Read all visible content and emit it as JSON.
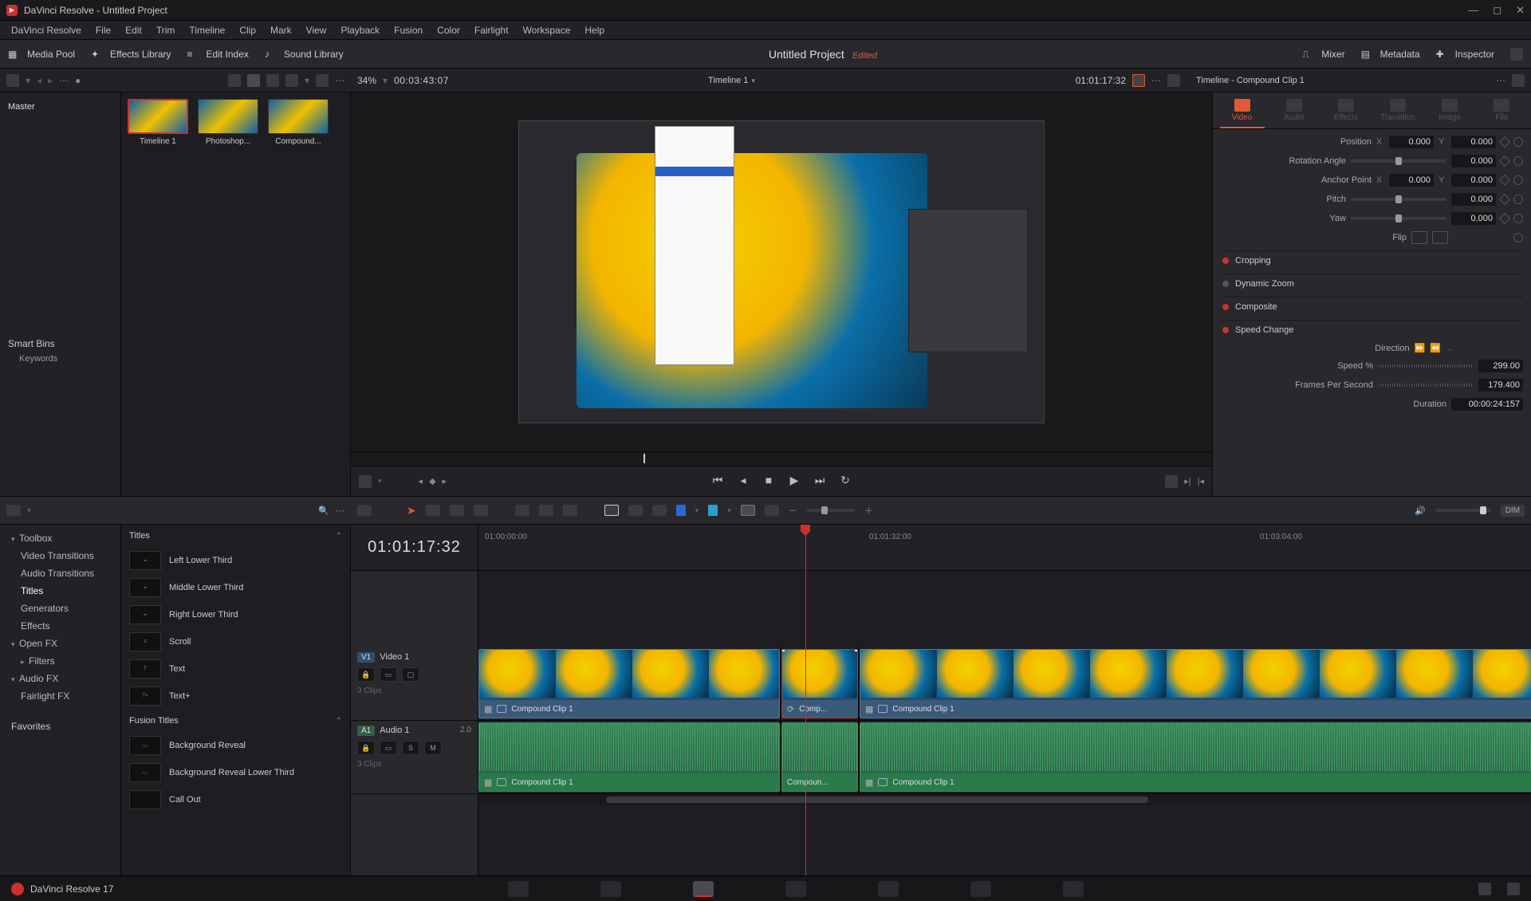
{
  "app": {
    "title": "DaVinci Resolve - Untitled Project"
  },
  "menu": [
    "DaVinci Resolve",
    "File",
    "Edit",
    "Trim",
    "Timeline",
    "Clip",
    "Mark",
    "View",
    "Playback",
    "Fusion",
    "Color",
    "Fairlight",
    "Workspace",
    "Help"
  ],
  "shelf": {
    "media_pool": "Media Pool",
    "effects_library": "Effects Library",
    "edit_index": "Edit Index",
    "sound_library": "Sound Library",
    "project": "Untitled Project",
    "edited": "Edited",
    "mixer": "Mixer",
    "metadata": "Metadata",
    "inspector": "Inspector"
  },
  "toolrow": {
    "zoom": "34%",
    "src_tc": "00:03:43:07",
    "viewer_tab": "Timeline 1",
    "rec_tc": "01:01:17:32",
    "inspector_title": "Timeline - Compound Clip 1"
  },
  "bins": {
    "master": "Master",
    "smart_bins": "Smart Bins",
    "keywords": "Keywords"
  },
  "thumbs": [
    {
      "label": "Timeline 1",
      "selected": true
    },
    {
      "label": "Photoshop...",
      "selected": false
    },
    {
      "label": "Compound...",
      "selected": false
    }
  ],
  "inspector": {
    "tabs": [
      "Video",
      "Audio",
      "Effects",
      "Transition",
      "Image",
      "File"
    ],
    "active_tab": "Video",
    "position_label": "Position",
    "pos_x": "0.000",
    "pos_y": "0.000",
    "rotation_label": "Rotation Angle",
    "rotation": "0.000",
    "anchor_label": "Anchor Point",
    "anchor_x": "0.000",
    "anchor_y": "0.000",
    "pitch_label": "Pitch",
    "pitch": "0.000",
    "yaw_label": "Yaw",
    "yaw": "0.000",
    "flip_label": "Flip",
    "cropping": "Cropping",
    "dynamic_zoom": "Dynamic Zoom",
    "composite": "Composite",
    "speed_change": "Speed Change",
    "direction_label": "Direction",
    "speed_label": "Speed %",
    "speed_val": "299.00",
    "fps_label": "Frames Per Second",
    "fps_val": "179.400",
    "duration_label": "Duration",
    "duration_val": "00:00:24:157"
  },
  "fx_tree": {
    "toolbox": "Toolbox",
    "video_transitions": "Video Transitions",
    "audio_transitions": "Audio Transitions",
    "titles": "Titles",
    "generators": "Generators",
    "effects": "Effects",
    "open_fx": "Open FX",
    "filters": "Filters",
    "audio_fx": "Audio FX",
    "fairlight_fx": "Fairlight FX",
    "favorites": "Favorites"
  },
  "fx_list": {
    "titles_head": "Titles",
    "items": [
      "Left Lower Third",
      "Middle Lower Third",
      "Right Lower Third",
      "Scroll",
      "Text",
      "Text+"
    ],
    "fusion_head": "Fusion Titles",
    "fusion_items": [
      "Background Reveal",
      "Background Reveal Lower Third",
      "Call Out"
    ]
  },
  "timeline": {
    "big_tc": "01:01:17:32",
    "ruler": [
      "01:00:00:00",
      "01:01:32:00",
      "01:03:04:00"
    ],
    "video_track": {
      "tag": "V1",
      "name": "Video 1",
      "clips_sub": "3 Clips"
    },
    "audio_track": {
      "tag": "A1",
      "name": "Audio 1",
      "ch": "2.0",
      "clips_sub": "3 Clips"
    },
    "clip1": "Compound Clip 1",
    "clip2": "Comp...",
    "clip2_audio": "Compoun...",
    "clip3": "Compound Clip 1"
  },
  "footer": {
    "brand": "DaVinci Resolve 17"
  },
  "midrow": {
    "dim": "DIM"
  }
}
